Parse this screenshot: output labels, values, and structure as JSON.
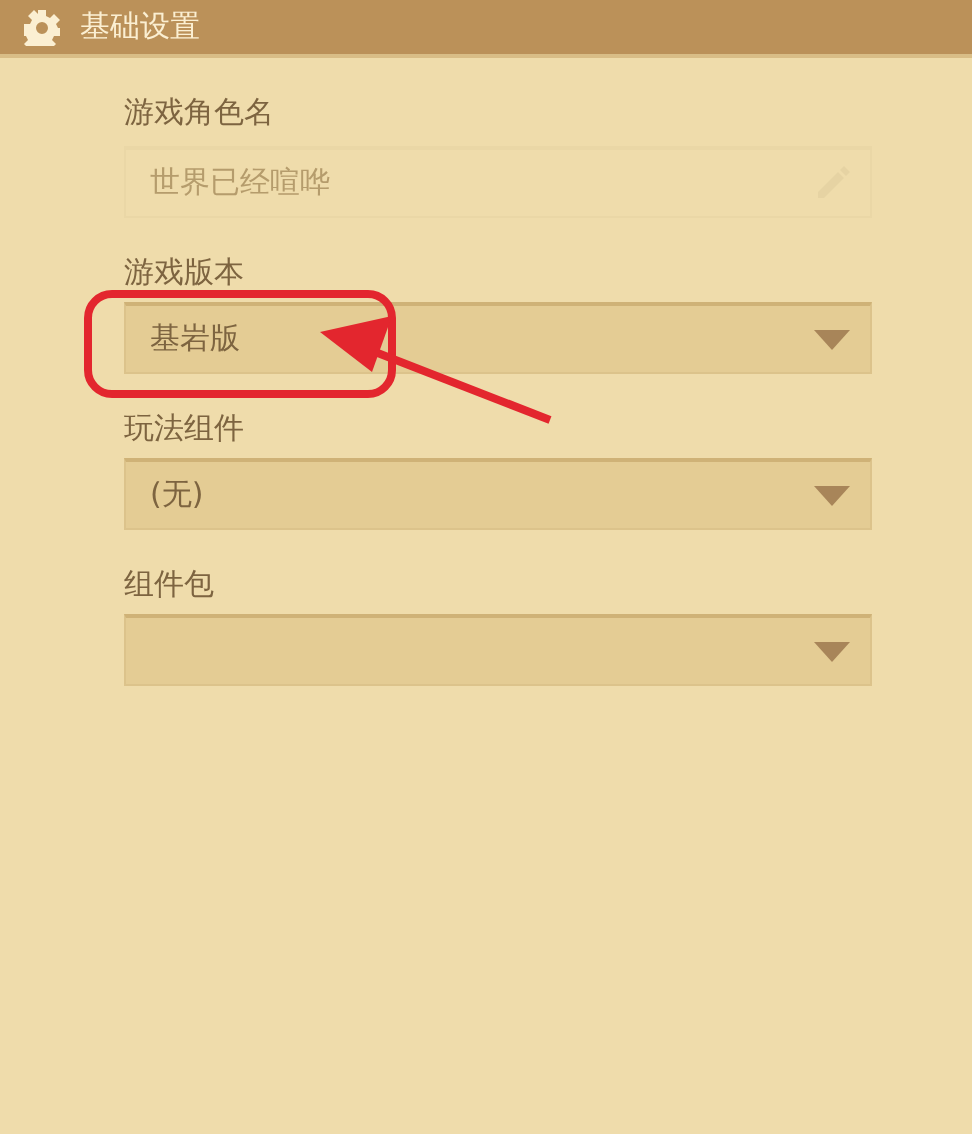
{
  "header": {
    "title": "基础设置"
  },
  "fields": [
    {
      "kind": "text",
      "label": "游戏角色名",
      "value": "世界已经喧哗",
      "disabled": true
    },
    {
      "kind": "select",
      "label": "游戏版本",
      "value": "基岩版",
      "disabled": false
    },
    {
      "kind": "select",
      "label": "玩法组件",
      "value": "(无)",
      "disabled": false
    },
    {
      "kind": "select",
      "label": "组件包",
      "disabled": false
    }
  ]
}
